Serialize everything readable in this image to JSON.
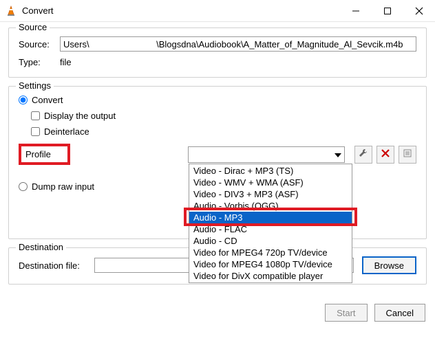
{
  "window": {
    "title": "Convert"
  },
  "source_group": {
    "legend": "Source",
    "source_label": "Source:",
    "source_value": "Users\\                           \\Blogsdna\\Audiobook\\A_Matter_of_Magnitude_Al_Sevcik.m4b",
    "type_label": "Type:",
    "type_value": "file"
  },
  "settings_group": {
    "legend": "Settings",
    "convert_label": "Convert",
    "display_output_label": "Display the output",
    "deinterlace_label": "Deinterlace",
    "profile_label": "Profile",
    "dump_raw_label": "Dump raw input",
    "profile_options": [
      "Video - Dirac + MP3 (TS)",
      "Video - WMV + WMA (ASF)",
      "Video - DIV3 + MP3 (ASF)",
      "Audio - Vorbis (OGG)",
      "Audio - MP3",
      "Audio - FLAC",
      "Audio - CD",
      "Video for MPEG4 720p TV/device",
      "Video for MPEG4 1080p TV/device",
      "Video for DivX compatible player"
    ],
    "profile_selected_index": 4,
    "tool_settings_title": "settings",
    "tool_delete_title": "delete",
    "tool_new_title": "new"
  },
  "destination_group": {
    "legend": "Destination",
    "dest_label": "Destination file:",
    "dest_value": "",
    "browse_label": "Browse"
  },
  "footer": {
    "start_label": "Start",
    "cancel_label": "Cancel"
  }
}
